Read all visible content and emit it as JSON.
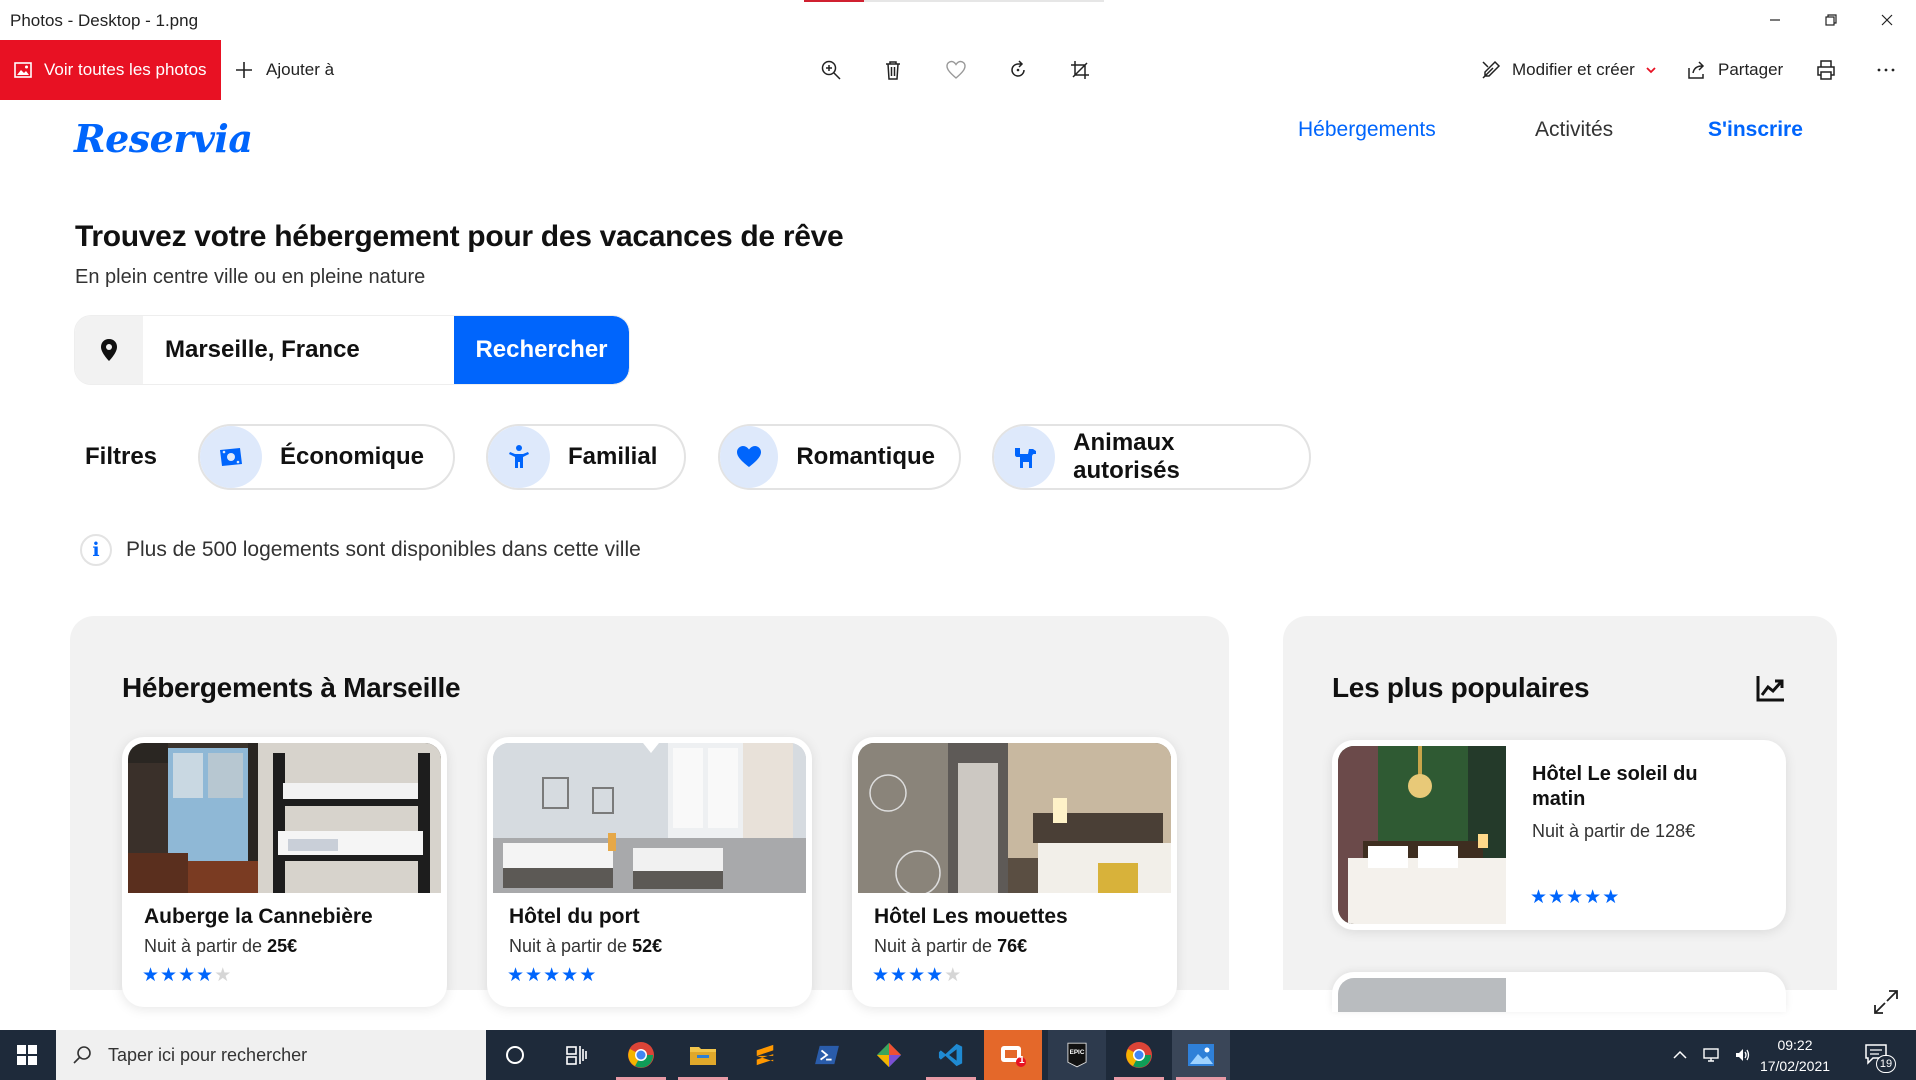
{
  "window": {
    "title": "Photos - Desktop - 1.png"
  },
  "toolbar": {
    "see_all_label": "Voir toutes les photos",
    "add_to_label": "Ajouter à",
    "edit_create_label": "Modifier et créer",
    "share_label": "Partager",
    "accent_color": "#e81123"
  },
  "site": {
    "logo": "Reservia",
    "nav": {
      "accommodations": "Hébergements",
      "activities": "Activités",
      "signup": "S'inscrire"
    },
    "hero": {
      "title": "Trouvez votre hébergement pour des vacances de rêve",
      "subtitle": "En plein centre ville ou en pleine nature"
    },
    "search": {
      "value": "Marseille, France",
      "button": "Rechercher"
    },
    "filters": {
      "label": "Filtres",
      "items": [
        {
          "label": "Économique",
          "icon": "money-icon"
        },
        {
          "label": "Familial",
          "icon": "child-icon"
        },
        {
          "label": "Romantique",
          "icon": "heart-icon"
        },
        {
          "label": "Animaux autorisés",
          "icon": "dog-icon"
        }
      ]
    },
    "info_text": "Plus de 500 logements sont disponibles dans cette ville",
    "listings": {
      "title": "Hébergements à Marseille",
      "price_prefix": "Nuit à partir de",
      "items": [
        {
          "name": "Auberge la Cannebière",
          "price": "25€",
          "rating": 4
        },
        {
          "name": "Hôtel du port",
          "price": "52€",
          "rating": 5
        },
        {
          "name": "Hôtel Les mouettes",
          "price": "76€",
          "rating": 4
        }
      ]
    },
    "popular": {
      "title": "Les plus populaires",
      "items": [
        {
          "name": "Hôtel Le soleil du matin",
          "price_text": "Nuit à partir de 128€",
          "rating": 5
        }
      ]
    },
    "brand_color": "#0065fc"
  },
  "taskbar": {
    "search_placeholder": "Taper ici pour rechercher",
    "time": "09:22",
    "date": "17/02/2021",
    "notification_count": "19",
    "mail_badge": "1"
  }
}
